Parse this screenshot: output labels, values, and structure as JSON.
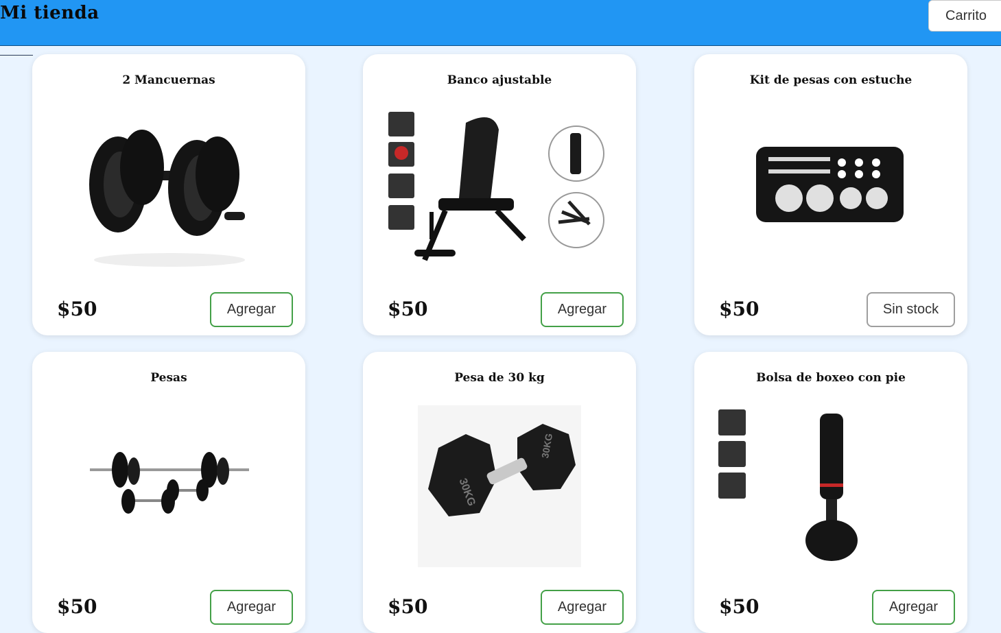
{
  "header": {
    "brand": "Mi tienda",
    "cart_label": "Carrito"
  },
  "products": [
    {
      "name": "2 Mancuernas",
      "price": "$50",
      "action": "Agregar",
      "in_stock": true
    },
    {
      "name": "Banco ajustable",
      "price": "$50",
      "action": "Agregar",
      "in_stock": true
    },
    {
      "name": "Kit de pesas con estuche",
      "price": "$50",
      "action": "Sin stock",
      "in_stock": false
    },
    {
      "name": "Pesas",
      "price": "$50",
      "action": "Agregar",
      "in_stock": true
    },
    {
      "name": "Pesa de 30 kg",
      "price": "$50",
      "action": "Agregar",
      "in_stock": true
    },
    {
      "name": "Bolsa de boxeo con pie",
      "price": "$50",
      "action": "Agregar",
      "in_stock": true
    }
  ],
  "colors": {
    "header": "#2196f3",
    "page_bg": "#eaf4ff",
    "add_border": "#43a047",
    "out_border": "#9e9e9e"
  },
  "image_labels": {
    "hex_dumbbell": "30KG"
  }
}
